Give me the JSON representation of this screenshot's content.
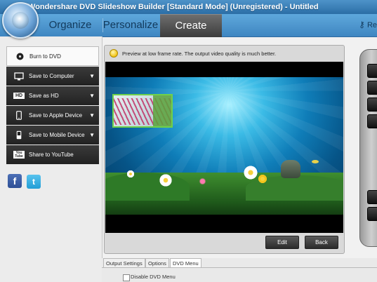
{
  "window": {
    "title": "Wondershare DVD Slideshow Builder [Standard Mode] (Unregistered) - Untitled"
  },
  "tabs": {
    "organize": "Organize",
    "personalize": "Personalize",
    "create": "Create"
  },
  "register": {
    "label": "Re"
  },
  "sidebar": {
    "items": [
      {
        "label": "Burn to DVD",
        "icon": "disc-icon"
      },
      {
        "label": "Save to Computer",
        "icon": "monitor-icon"
      },
      {
        "label": "Save as HD",
        "icon": "hd-icon"
      },
      {
        "label": "Save to Apple Device",
        "icon": "phone-icon"
      },
      {
        "label": "Save to Mobile Device",
        "icon": "mobile-icon"
      },
      {
        "label": "Share to YouTube",
        "icon": "youtube-icon"
      }
    ],
    "hd_badge": "HD",
    "youtube_badge": "You Tube",
    "social": {
      "facebook": "f",
      "twitter": "t"
    }
  },
  "preview": {
    "tip": "Preview at low frame rate. The output video quality is much better.",
    "edit_label": "Edit",
    "back_label": "Back"
  },
  "bottom": {
    "tabs": [
      "Output Settings",
      "Options",
      "DVD Menu"
    ],
    "disable_menu_label": "Disable DVD Menu"
  }
}
